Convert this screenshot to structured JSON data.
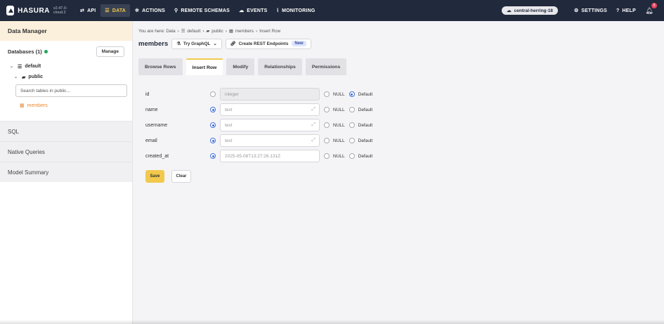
{
  "topnav": {
    "logo_text": "HASURA",
    "version": "v2.47.0-cloud.2",
    "items": [
      {
        "label": "API",
        "icon": "api-icon",
        "glyph": "⇄"
      },
      {
        "label": "DATA",
        "icon": "database-icon",
        "glyph": "☰",
        "active": true
      },
      {
        "label": "ACTIONS",
        "icon": "actions-icon",
        "glyph": "✲"
      },
      {
        "label": "REMOTE SCHEMAS",
        "icon": "plug-icon",
        "glyph": "⚲"
      },
      {
        "label": "EVENTS",
        "icon": "cloud-icon",
        "glyph": "☁"
      },
      {
        "label": "MONITORING",
        "icon": "chart-icon",
        "glyph": "⌇"
      }
    ],
    "project": "central-herring-18",
    "settings_label": "SETTINGS",
    "help_label": "HELP",
    "notification_count": "9"
  },
  "sidebar": {
    "title": "Data Manager",
    "databases_label": "Databases (1)",
    "manage_label": "Manage",
    "db_name": "default",
    "schema_name": "public",
    "search_placeholder": "Search tables in public...",
    "table_name": "members",
    "sections": [
      "SQL",
      "Native Queries",
      "Model Summary"
    ]
  },
  "breadcrumb": {
    "prefix": "You are here: Data",
    "db": "default",
    "schema": "public",
    "table": "members",
    "current": "Insert Row"
  },
  "header": {
    "title": "members",
    "graphql_label": "Try GraphQL",
    "rest_label": "Create REST Endpoints",
    "new_badge": "New"
  },
  "tabs": [
    "Browse Rows",
    "Insert Row",
    "Modify",
    "Relationships",
    "Permissions"
  ],
  "active_tab": "Insert Row",
  "form": {
    "null_label": "NULL",
    "default_label": "Default",
    "rows": [
      {
        "name": "id",
        "placeholder": "integer",
        "value_selected": false,
        "null_selected": false,
        "default_selected": true,
        "disabled": true
      },
      {
        "name": "name",
        "placeholder": "text",
        "value_selected": true,
        "null_selected": false,
        "default_selected": false,
        "disabled": false
      },
      {
        "name": "username",
        "placeholder": "text",
        "value_selected": true,
        "null_selected": false,
        "default_selected": false,
        "disabled": false
      },
      {
        "name": "email",
        "placeholder": "text",
        "value_selected": true,
        "null_selected": false,
        "default_selected": false,
        "disabled": false
      },
      {
        "name": "created_at",
        "placeholder": "2025-05-08T13:27:26.131Z",
        "value_selected": true,
        "null_selected": false,
        "default_selected": false,
        "disabled": false
      }
    ],
    "save_label": "Save",
    "clear_label": "Clear"
  },
  "colors": {
    "nav_bg": "#212a3c",
    "accent": "#f2c94c",
    "radio_selected": "#3f6fd8",
    "table_link": "#e88a2f"
  }
}
